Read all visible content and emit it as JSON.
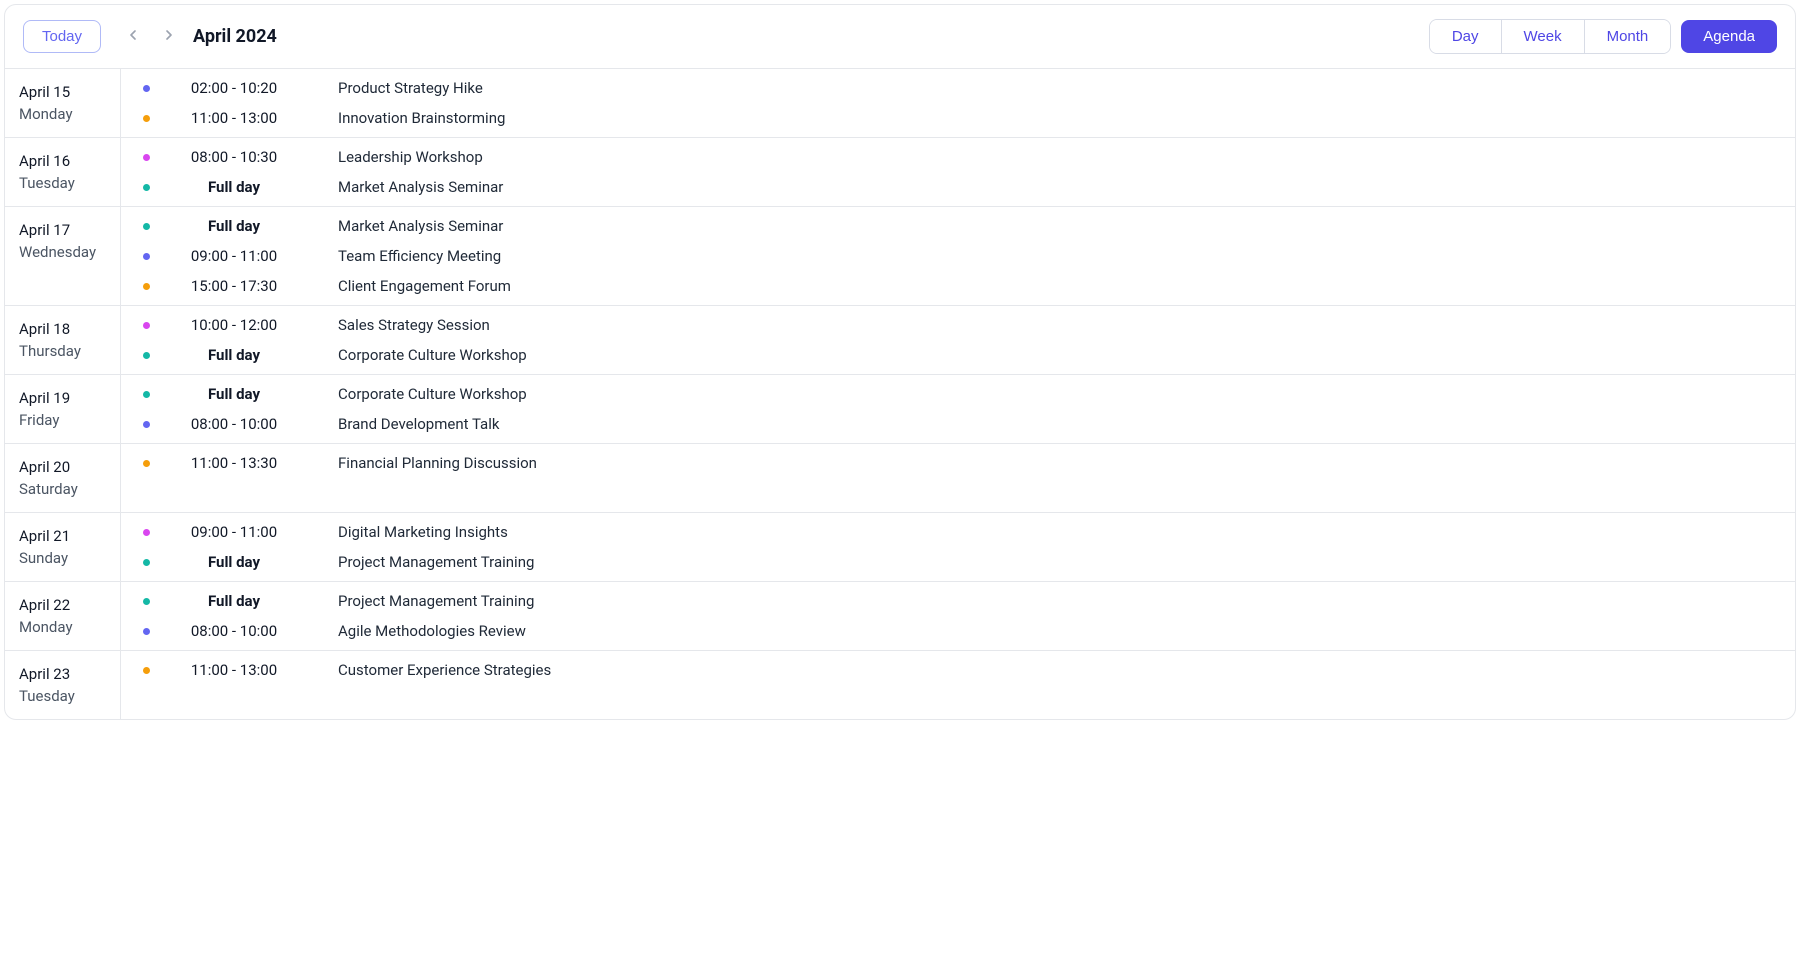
{
  "header": {
    "today_label": "Today",
    "month_title": "April 2024",
    "views": {
      "day": "Day",
      "week": "Week",
      "month": "Month",
      "agenda": "Agenda"
    }
  },
  "full_day_label": "Full day",
  "colors": {
    "indigo": "#6366f1",
    "amber": "#f59e0b",
    "fuchsia": "#d946ef",
    "teal": "#14b8a6"
  },
  "days": [
    {
      "date": "April 15",
      "weekday": "Monday",
      "events": [
        {
          "color": "indigo",
          "time": "02:00 - 10:20",
          "title": "Product Strategy Hike",
          "full_day": false
        },
        {
          "color": "amber",
          "time": "11:00 - 13:00",
          "title": "Innovation Brainstorming",
          "full_day": false
        }
      ]
    },
    {
      "date": "April 16",
      "weekday": "Tuesday",
      "events": [
        {
          "color": "fuchsia",
          "time": "08:00 - 10:30",
          "title": "Leadership Workshop",
          "full_day": false
        },
        {
          "color": "teal",
          "time": "Full day",
          "title": "Market Analysis Seminar",
          "full_day": true
        }
      ]
    },
    {
      "date": "April 17",
      "weekday": "Wednesday",
      "events": [
        {
          "color": "teal",
          "time": "Full day",
          "title": "Market Analysis Seminar",
          "full_day": true
        },
        {
          "color": "indigo",
          "time": "09:00 - 11:00",
          "title": "Team Efficiency Meeting",
          "full_day": false
        },
        {
          "color": "amber",
          "time": "15:00 - 17:30",
          "title": "Client Engagement Forum",
          "full_day": false
        }
      ]
    },
    {
      "date": "April 18",
      "weekday": "Thursday",
      "events": [
        {
          "color": "fuchsia",
          "time": "10:00 - 12:00",
          "title": "Sales Strategy Session",
          "full_day": false
        },
        {
          "color": "teal",
          "time": "Full day",
          "title": "Corporate Culture Workshop",
          "full_day": true
        }
      ]
    },
    {
      "date": "April 19",
      "weekday": "Friday",
      "events": [
        {
          "color": "teal",
          "time": "Full day",
          "title": "Corporate Culture Workshop",
          "full_day": true
        },
        {
          "color": "indigo",
          "time": "08:00 - 10:00",
          "title": "Brand Development Talk",
          "full_day": false
        }
      ]
    },
    {
      "date": "April 20",
      "weekday": "Saturday",
      "events": [
        {
          "color": "amber",
          "time": "11:00 - 13:30",
          "title": "Financial Planning Discussion",
          "full_day": false
        }
      ]
    },
    {
      "date": "April 21",
      "weekday": "Sunday",
      "events": [
        {
          "color": "fuchsia",
          "time": "09:00 - 11:00",
          "title": "Digital Marketing Insights",
          "full_day": false
        },
        {
          "color": "teal",
          "time": "Full day",
          "title": "Project Management Training",
          "full_day": true
        }
      ]
    },
    {
      "date": "April 22",
      "weekday": "Monday",
      "events": [
        {
          "color": "teal",
          "time": "Full day",
          "title": "Project Management Training",
          "full_day": true
        },
        {
          "color": "indigo",
          "time": "08:00 - 10:00",
          "title": "Agile Methodologies Review",
          "full_day": false
        }
      ]
    },
    {
      "date": "April 23",
      "weekday": "Tuesday",
      "events": [
        {
          "color": "amber",
          "time": "11:00 - 13:00",
          "title": "Customer Experience Strategies",
          "full_day": false
        }
      ]
    }
  ]
}
